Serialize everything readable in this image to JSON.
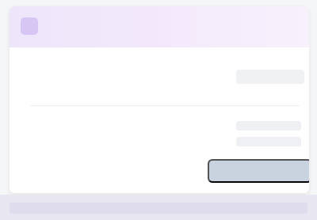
{
  "header": {
    "title": ""
  },
  "section": {
    "title": ""
  },
  "fields": {
    "top_right": "",
    "row1_label": "",
    "row1_value": "",
    "row2_label": "",
    "row2_value": ""
  },
  "actions": {
    "primary_label": ""
  },
  "colors": {
    "header_gradient_start": "#ede6fb",
    "header_gradient_end": "#f7f1fc",
    "accent": "#8b6fd6",
    "button": "#c9d2df",
    "footer": "#e7e6f1"
  },
  "icons": {
    "app": "app-icon"
  }
}
